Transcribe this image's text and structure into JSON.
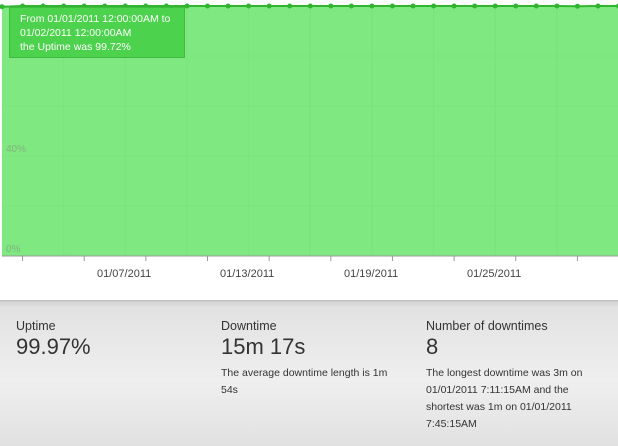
{
  "chart": {
    "tooltip": {
      "line1": "From 01/01/2011 12:00:00AM to",
      "line2": "01/02/2011 12:00:00AM",
      "line3": "the Uptime was 99.72%"
    },
    "y_ticks": [
      "40%",
      "0%"
    ],
    "x_ticks": [
      "01/07/2011",
      "01/13/2011",
      "01/19/2011",
      "01/25/2011"
    ],
    "colors": {
      "fill": "#80e880",
      "line": "#2fb52f",
      "grid": "#6cd06c",
      "tooltip": "#4cd24c"
    }
  },
  "chart_data": {
    "type": "area",
    "x_labels": [
      "01/07/2011",
      "01/13/2011",
      "01/19/2011",
      "01/25/2011"
    ],
    "y_tick_labels": [
      "40%",
      "0%"
    ],
    "ylim": [
      0,
      100
    ],
    "series": [
      {
        "values": [
          99.72,
          100,
          100,
          100,
          100,
          100,
          100,
          100,
          100,
          100,
          100,
          100,
          100,
          100,
          100,
          100,
          100,
          100,
          100,
          100,
          100,
          100,
          100,
          100,
          100,
          100,
          100,
          100,
          99.9,
          100,
          100
        ]
      }
    ]
  },
  "stats": {
    "uptime": {
      "label": "Uptime",
      "value": "99.97%"
    },
    "downtime": {
      "label": "Downtime",
      "value": "15m 17s",
      "desc1": "The average downtime length is 1m",
      "desc2": "54s"
    },
    "downtimes": {
      "label": "Number of downtimes",
      "value": "8",
      "desc1": "The longest downtime was 3m on",
      "desc2": "01/01/2011 7:11:15AM and the",
      "desc3": "shortest was 1m on 01/01/2011",
      "desc4": "7:45:15AM"
    }
  }
}
